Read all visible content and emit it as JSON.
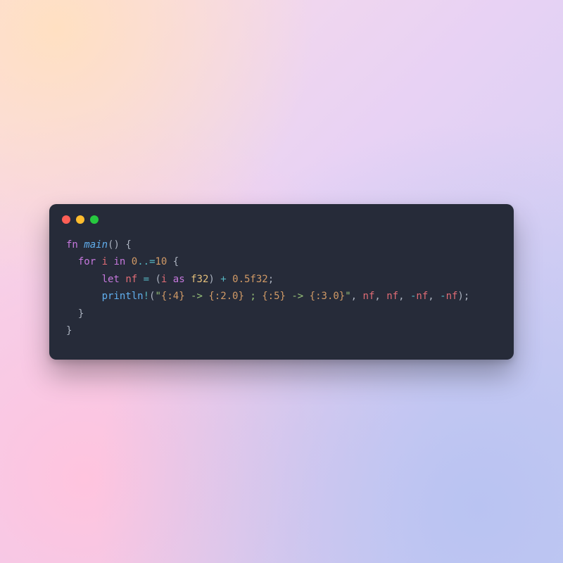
{
  "window_controls": {
    "red": "close-icon",
    "yellow": "minimize-icon",
    "green": "zoom-icon"
  },
  "code": {
    "line1": {
      "kw_fn": "fn",
      "fn_name": "main",
      "parens": "()",
      "brace_open": "{"
    },
    "line2": {
      "kw_for": "for",
      "var_i": "i",
      "kw_in": "in",
      "num_zero": "0",
      "op_range": "..",
      "op_eq": "=",
      "num_ten": "10",
      "brace_open": "{"
    },
    "line3": {
      "kw_let": "let",
      "var_nf": "nf",
      "op_assign": "=",
      "paren_open": "(",
      "var_i": "i",
      "kw_as": "as",
      "type_f32": "f32",
      "paren_close": ")",
      "op_plus": "+",
      "num_half": "0.5f32",
      "semi": ";"
    },
    "line4": {
      "fn_println": "println",
      "bang": "!",
      "paren_open": "(",
      "str_open": "\"",
      "ph1": "{:4}",
      "arrow1": " -> ",
      "ph2": "{:2.0}",
      "sep": " ; ",
      "ph3": "{:5}",
      "arrow2": " -> ",
      "ph4": "{:3.0}",
      "str_close": "\"",
      "comma": ", ",
      "arg_nf": "nf",
      "op_neg": "-",
      "paren_close": ")",
      "semi": ";"
    },
    "line5": {
      "brace_close": "}"
    },
    "line6": {
      "brace_close": "}"
    }
  }
}
